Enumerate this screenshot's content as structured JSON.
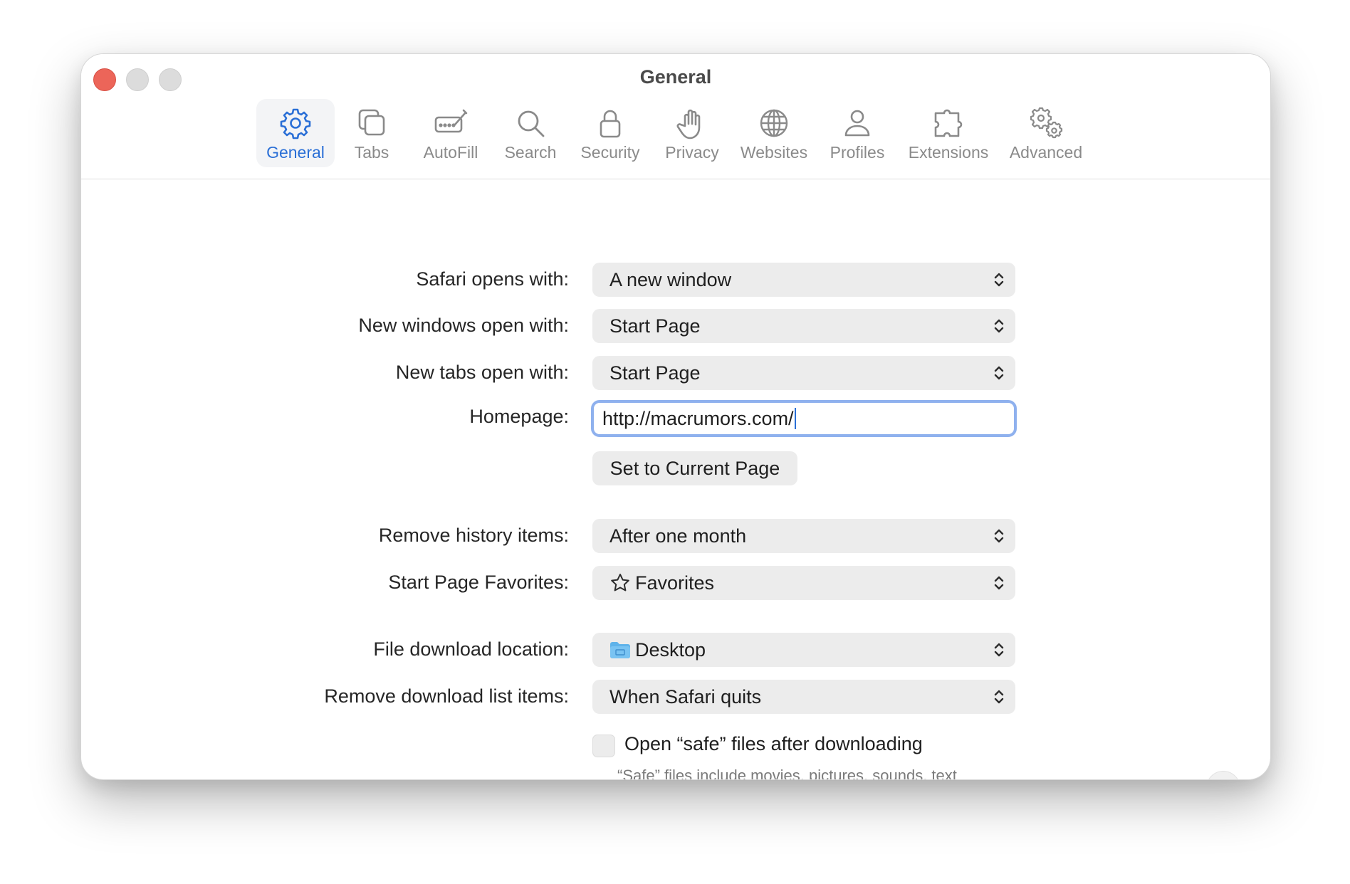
{
  "window": {
    "title": "General"
  },
  "toolbar": {
    "items": [
      {
        "label": "General",
        "icon": "gear-icon",
        "active": true
      },
      {
        "label": "Tabs",
        "icon": "tabs-icon"
      },
      {
        "label": "AutoFill",
        "icon": "autofill-icon"
      },
      {
        "label": "Search",
        "icon": "search-icon"
      },
      {
        "label": "Security",
        "icon": "lock-icon"
      },
      {
        "label": "Privacy",
        "icon": "hand-icon"
      },
      {
        "label": "Websites",
        "icon": "globe-icon"
      },
      {
        "label": "Profiles",
        "icon": "person-icon"
      },
      {
        "label": "Extensions",
        "icon": "puzzle-icon"
      },
      {
        "label": "Advanced",
        "icon": "gears-icon"
      }
    ]
  },
  "general": {
    "safari_opens_with": {
      "label": "Safari opens with:",
      "value": "A new window"
    },
    "new_windows_open_with": {
      "label": "New windows open with:",
      "value": "Start Page"
    },
    "new_tabs_open_with": {
      "label": "New tabs open with:",
      "value": "Start Page"
    },
    "homepage": {
      "label": "Homepage:",
      "value": "http://macrumors.com/"
    },
    "set_current_page_label": "Set to Current Page",
    "remove_history": {
      "label": "Remove history items:",
      "value": "After one month"
    },
    "favorites": {
      "label": "Start Page Favorites:",
      "value": "Favorites",
      "icon": "star-icon"
    },
    "download_location": {
      "label": "File download location:",
      "value": "Desktop",
      "icon": "folder-icon"
    },
    "remove_downloads": {
      "label": "Remove download list items:",
      "value": "When Safari quits"
    },
    "open_safe_files": {
      "label": "Open “safe” files after downloading",
      "checked": false
    },
    "safe_files_note": "“Safe” files include movies, pictures, sounds, text documents, and archives."
  },
  "help_label": "?",
  "colors": {
    "accent": "#2a6fd6",
    "close": "#ec6559",
    "focus_ring": "#8fb1ee"
  }
}
